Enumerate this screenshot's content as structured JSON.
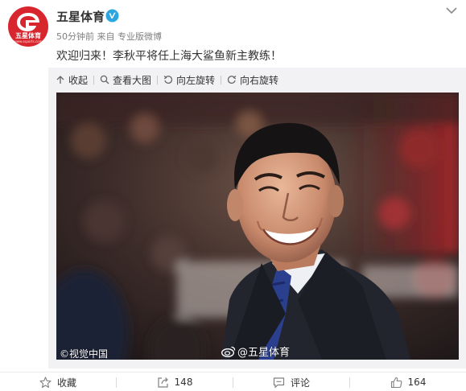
{
  "post": {
    "author": "五星体育",
    "avatar_text": "五星体育",
    "avatar_subtext": "www.ssports.com",
    "time": "50分钟前",
    "source_prefix": "来自",
    "source": "专业版微博",
    "text": "欢迎归来！李秋平将任上海大鲨鱼新主教练！"
  },
  "media_toolbar": {
    "collapse": "收起",
    "view_large": "查看大图",
    "rotate_left": "向左旋转",
    "rotate_right": "向右旋转"
  },
  "photo": {
    "watermark_left": "©视觉中国",
    "watermark_right": "@五星体育"
  },
  "actions": {
    "favorite": "收藏",
    "repost_count": "148",
    "comment": "评论",
    "like_count": "164"
  },
  "colors": {
    "brand_red": "#d8262f",
    "verified_blue": "#2da6e0",
    "text": "#333333",
    "meta": "#808080",
    "media_bg": "#f2f2f5"
  },
  "icons": [
    "weibo-logo-icon",
    "verified-icon",
    "chevron-down-icon",
    "collapse-icon",
    "search-icon",
    "rotate-left-icon",
    "rotate-right-icon",
    "weibo-watermark-icon",
    "star-icon",
    "repost-icon",
    "comment-icon",
    "like-icon"
  ]
}
